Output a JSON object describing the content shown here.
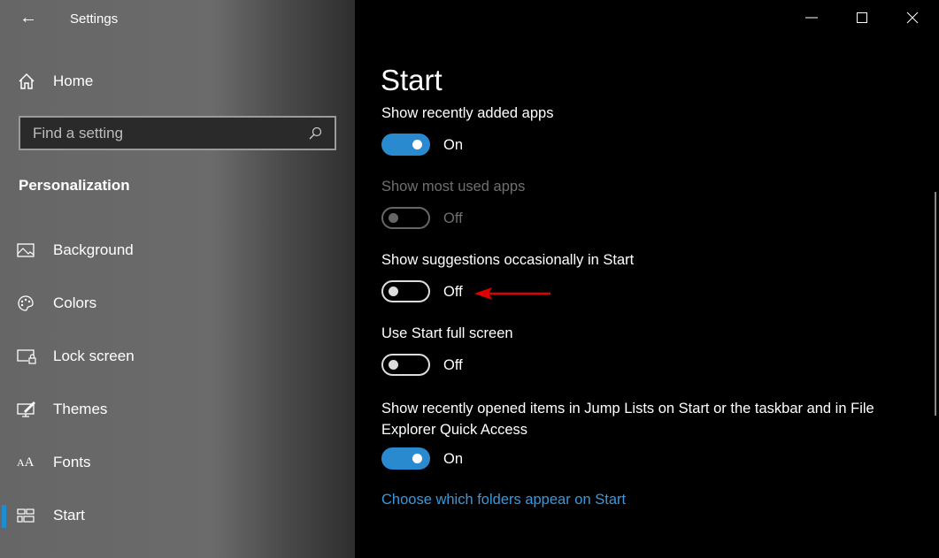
{
  "window": {
    "title": "Settings",
    "back_icon": "back-arrow-icon",
    "controls": [
      "minimize",
      "maximize",
      "close"
    ]
  },
  "sidebar": {
    "home": "Home",
    "search": {
      "placeholder": "Find a setting",
      "value": ""
    },
    "section": "Personalization",
    "items": [
      {
        "label": "Background",
        "icon": "image-icon"
      },
      {
        "label": "Colors",
        "icon": "palette-icon"
      },
      {
        "label": "Lock screen",
        "icon": "lock-screen-icon"
      },
      {
        "label": "Themes",
        "icon": "themes-icon"
      },
      {
        "label": "Fonts",
        "icon": "fonts-icon"
      },
      {
        "label": "Start",
        "icon": "start-tiles-icon",
        "selected": true
      }
    ],
    "accent": "#1e8bd3"
  },
  "main": {
    "title": "Start",
    "settings": [
      {
        "label": "Show recently added apps",
        "state": "On",
        "enabled": true
      },
      {
        "label": "Show most used apps",
        "state": "Off",
        "enabled": false
      },
      {
        "label": "Show suggestions occasionally in Start",
        "state": "Off",
        "enabled": true,
        "annotated": true
      },
      {
        "label": "Use Start full screen",
        "state": "Off",
        "enabled": true
      },
      {
        "label": "Show recently opened items in Jump Lists on Start or the taskbar and in File Explorer Quick Access",
        "state": "On",
        "enabled": true
      }
    ],
    "link": "Choose which folders appear on Start",
    "toggle_on_color": "#2a8ad0",
    "annotation_color": "#e00000"
  }
}
